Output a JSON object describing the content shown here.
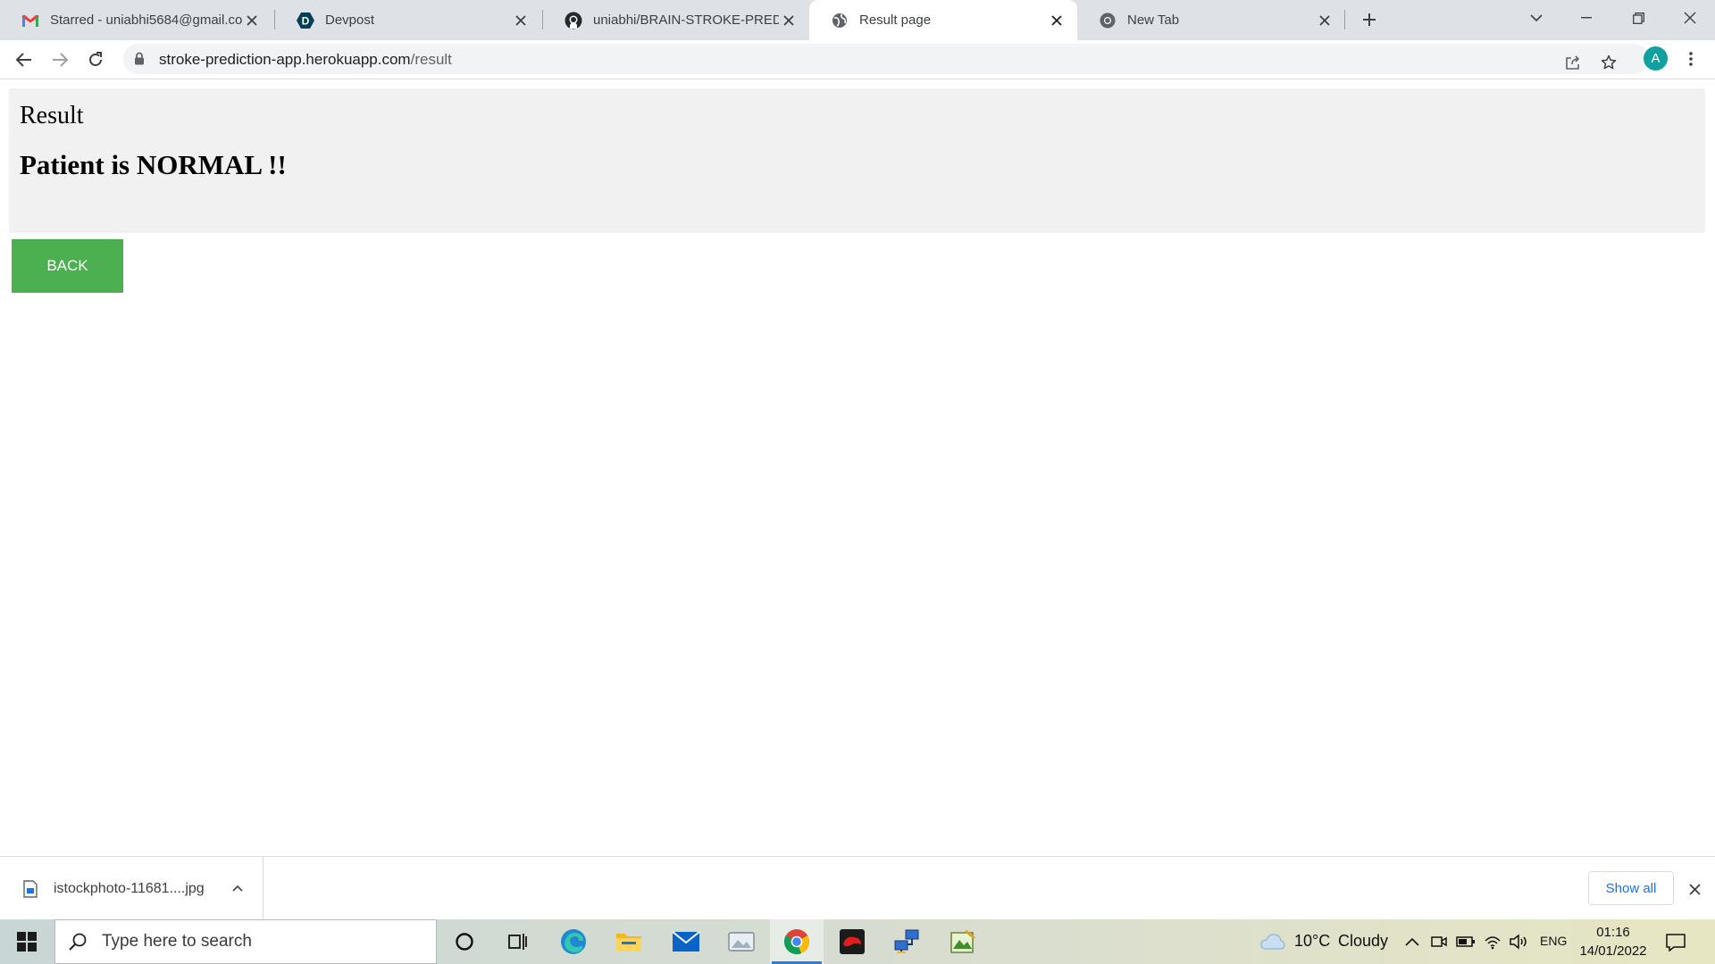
{
  "browser": {
    "tabs": [
      {
        "title": "Starred - uniabhi5684@gmail.com",
        "icon": "gmail-icon"
      },
      {
        "title": "Devpost",
        "icon": "devpost-icon"
      },
      {
        "title": "uniabhi/BRAIN-STROKE-PREDICTION",
        "icon": "github-icon"
      },
      {
        "title": "Result page",
        "icon": "globe-icon",
        "active": true
      },
      {
        "title": "New Tab",
        "icon": "chrome-icon"
      }
    ],
    "address": {
      "host": "stroke-prediction-app.herokuapp.com",
      "path": "/result"
    },
    "profile_initial": "A",
    "accent": "#11a0a0"
  },
  "page": {
    "heading": "Result",
    "message": "Patient is NORMAL !!",
    "back_button": "BACK",
    "button_color": "#4caf50"
  },
  "downloads": {
    "file_name": "istockphoto-11681....jpg",
    "show_all": "Show all"
  },
  "taskbar": {
    "search_placeholder": "Type here to search",
    "weather": {
      "temp": "10°C",
      "condition": "Cloudy"
    },
    "language": "ENG",
    "time": "01:16",
    "date": "14/01/2022"
  }
}
